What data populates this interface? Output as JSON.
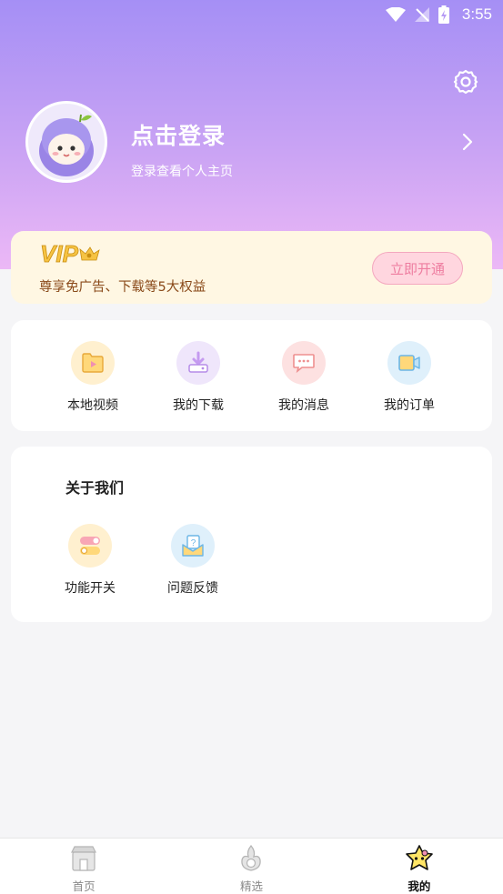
{
  "status_bar": {
    "time": "3:55",
    "icons": [
      "wifi-icon",
      "no-signal-icon",
      "battery-charging-icon"
    ]
  },
  "header": {
    "settings_icon": "gear-icon",
    "login_title": "点击登录",
    "login_subtitle": "登录查看个人主页",
    "chevron_icon": "chevron-right-icon"
  },
  "vip": {
    "logo_text": "VIP",
    "description": "尊享免广告、下载等5大权益",
    "button_label": "立即开通",
    "colors": {
      "logo": "#f6c343",
      "button_text": "#ee7da0",
      "button_bg": "#ffd6df"
    }
  },
  "shortcuts": [
    {
      "label": "本地视频",
      "icon": "local-video-icon",
      "bg": "#fff0cf"
    },
    {
      "label": "我的下载",
      "icon": "download-icon",
      "bg": "#efe6fb"
    },
    {
      "label": "我的消息",
      "icon": "message-icon",
      "bg": "#fde1e1"
    },
    {
      "label": "我的订单",
      "icon": "order-icon",
      "bg": "#dff0fb"
    }
  ],
  "about": {
    "title": "关于我们",
    "items": [
      {
        "label": "功能开关",
        "icon": "toggle-switch-icon",
        "bg": "#fff0cf"
      },
      {
        "label": "问题反馈",
        "icon": "feedback-icon",
        "bg": "#dff0fb"
      }
    ]
  },
  "bottom_nav": [
    {
      "label": "首页",
      "icon": "home-icon",
      "active": false
    },
    {
      "label": "精选",
      "icon": "featured-icon",
      "active": false
    },
    {
      "label": "我的",
      "icon": "mine-icon",
      "active": true
    }
  ],
  "accent_color": "#a58ff5"
}
